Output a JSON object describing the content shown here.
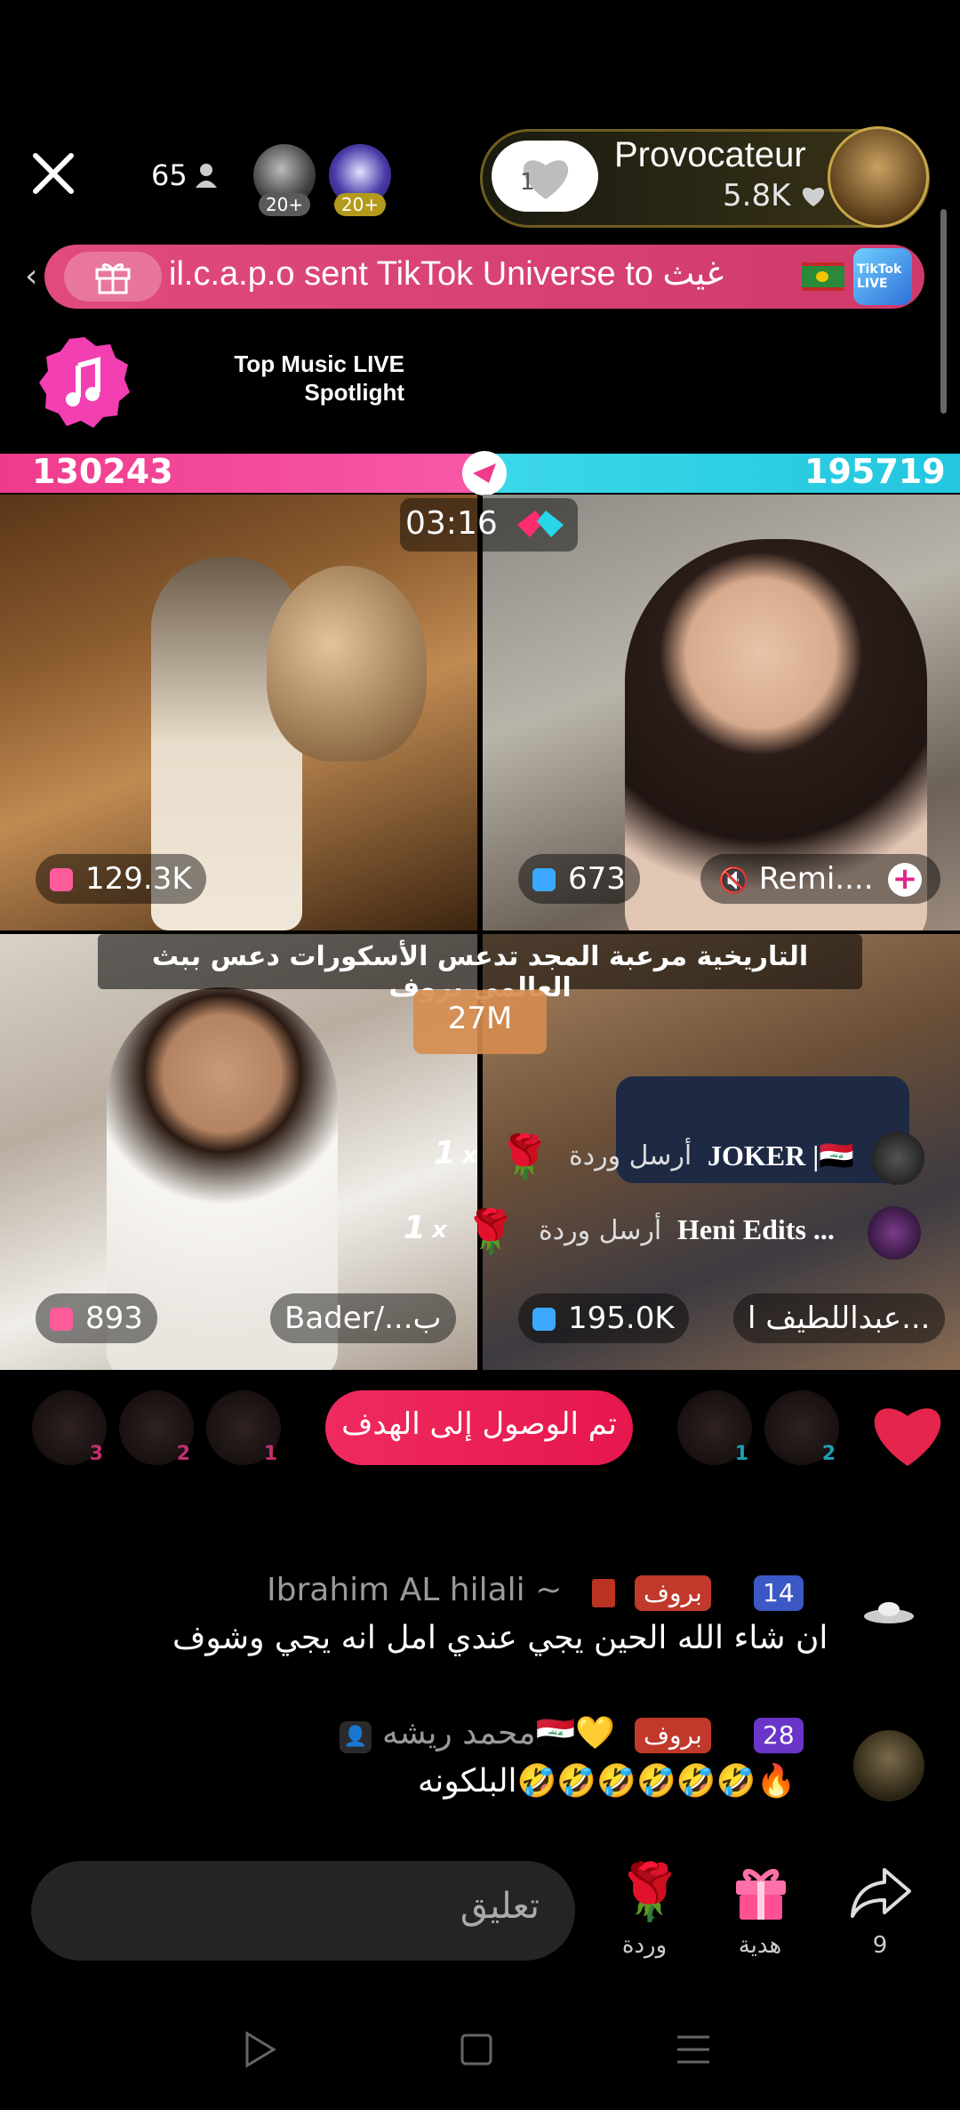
{
  "header": {
    "viewer_count": "65",
    "badge_1": "20+",
    "badge_2": "20+",
    "host_like_count": "1",
    "host_name": "Provocateur",
    "host_followers": "5.8K"
  },
  "gift_banner": {
    "text": "il.c.a.p.o sent TikTok Universe to غيث",
    "logo_label": "TikTok LIVE"
  },
  "music": {
    "line1": "Top Music LIVE",
    "line2": "Spotlight"
  },
  "battle": {
    "score_left": "130243",
    "score_right": "195719",
    "timer": "03:16",
    "caption": "التاريخية مرعبة المجد تدعس الأسكورات دعس ببث العالمي بروف",
    "goal": "27M"
  },
  "tiles": [
    {
      "score": "129.3K"
    },
    {
      "score": "673",
      "name": "Remi...."
    },
    {
      "score": "893",
      "name": "Bader/...ب"
    },
    {
      "score": "195.0K",
      "name": "عبداللطيف ا..."
    }
  ],
  "gift_feed": [
    {
      "name": "JOKER |🇮🇶",
      "action": "أرسل وردة",
      "count": "1",
      "x": "x"
    },
    {
      "name": "Heni Edits ...",
      "action": "أرسل وردة",
      "count": "1",
      "x": "x"
    }
  ],
  "ranks_left": [
    "3",
    "2",
    "1"
  ],
  "ranks_right": [
    "1",
    "2"
  ],
  "goal_reached": "تم الوصول إلى الهدف",
  "chat": [
    {
      "level": "14",
      "badge": "بروف",
      "name": "Ibrahim AL hilali ~",
      "message": "ان شاء الله الحين يجي عندي امل انه يجي وشوف"
    },
    {
      "level": "28",
      "badge": "بروف",
      "name": "محمد ريشه🇮🇶💛",
      "message": "البلكونه🤣🤣🤣🤣🤣🤣🔥"
    }
  ],
  "bottom": {
    "comment_placeholder": "تعليق",
    "rose_label": "وردة",
    "gift_label": "هدية",
    "share_count": "9"
  },
  "colors": {
    "accent_pink": "#ef2a5f",
    "score_pink": "#f03b8c",
    "score_cyan": "#22c6df"
  }
}
